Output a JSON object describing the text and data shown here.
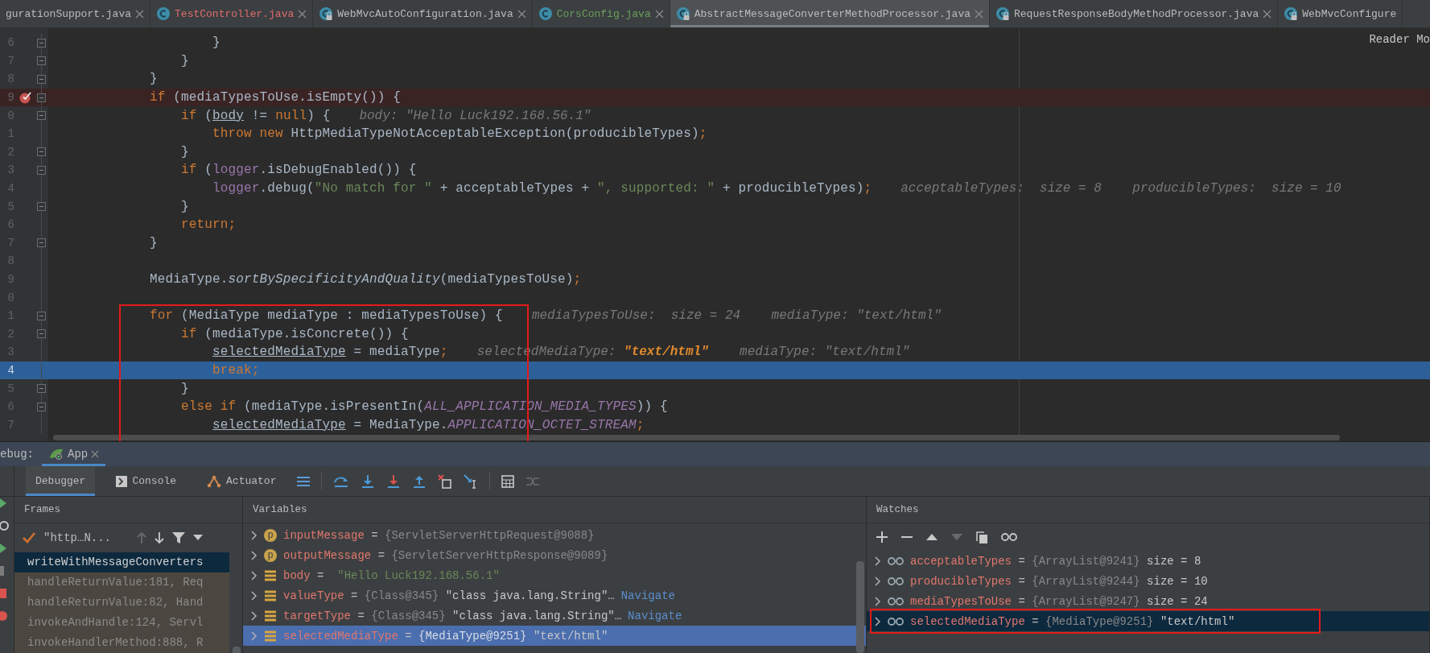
{
  "tabs": [
    {
      "label": "gurationSupport.java",
      "selected": false,
      "has_error": false,
      "is_new": false,
      "icon": false,
      "closable": true
    },
    {
      "label": "TestController.java",
      "selected": false,
      "has_error": true,
      "is_new": false,
      "icon": true,
      "locked": false,
      "closable": true
    },
    {
      "label": "WebMvcAutoConfiguration.java",
      "selected": false,
      "has_error": false,
      "is_new": false,
      "icon": true,
      "locked": true,
      "closable": true
    },
    {
      "label": "CorsConfig.java",
      "selected": false,
      "has_error": false,
      "is_new": true,
      "icon": true,
      "locked": false,
      "closable": true
    },
    {
      "label": "AbstractMessageConverterMethodProcessor.java",
      "selected": true,
      "has_error": false,
      "is_new": false,
      "icon": true,
      "locked": true,
      "closable": true
    },
    {
      "label": "RequestResponseBodyMethodProcessor.java",
      "selected": false,
      "has_error": false,
      "is_new": false,
      "icon": true,
      "locked": true,
      "closable": true
    },
    {
      "label": "WebMvcConfigure",
      "selected": false,
      "has_error": false,
      "is_new": false,
      "icon": true,
      "locked": true,
      "closable": false
    }
  ],
  "editor": {
    "reader_mode": "Reader Mo",
    "lines": [
      {
        "num": "6",
        "fold": true,
        "breakpoint": false,
        "current": false,
        "code": [
          {
            "kind": "plain",
            "t": "                }"
          }
        ]
      },
      {
        "num": "7",
        "fold": true,
        "breakpoint": false,
        "current": false,
        "code": [
          {
            "kind": "plain",
            "t": "            }"
          }
        ]
      },
      {
        "num": "8",
        "fold": true,
        "breakpoint": false,
        "current": false,
        "code": [
          {
            "kind": "plain",
            "t": "        }"
          }
        ]
      },
      {
        "num": "9",
        "fold": true,
        "breakpoint": true,
        "current": false,
        "code": [
          {
            "kind": "keyword",
            "t": "        if"
          },
          {
            "kind": "plain",
            "t": " (mediaTypesToUse.isEmpty()) {"
          }
        ]
      },
      {
        "num": "0",
        "fold": true,
        "breakpoint": false,
        "current": false,
        "code": [
          {
            "kind": "keyword",
            "t": "            if"
          },
          {
            "kind": "plain",
            "t": " ("
          },
          {
            "kind": "var",
            "t": "body"
          },
          {
            "kind": "plain",
            "t": " != "
          },
          {
            "kind": "keyword",
            "t": "null"
          },
          {
            "kind": "plain",
            "t": ") {"
          }
        ],
        "hint": [
          {
            "kind": "hint",
            "t": "body: \"Hello Luck192.168.56.1\""
          }
        ]
      },
      {
        "num": "1",
        "fold": false,
        "breakpoint": false,
        "current": false,
        "code": [
          {
            "kind": "keyword",
            "t": "                throw new"
          },
          {
            "kind": "plain",
            "t": " HttpMediaTypeNotAcceptableException(producibleTypes)"
          },
          {
            "kind": "keyword",
            "t": ";"
          }
        ]
      },
      {
        "num": "2",
        "fold": true,
        "breakpoint": false,
        "current": false,
        "code": [
          {
            "kind": "plain",
            "t": "            }"
          }
        ]
      },
      {
        "num": "3",
        "fold": true,
        "breakpoint": false,
        "current": false,
        "code": [
          {
            "kind": "keyword",
            "t": "            if"
          },
          {
            "kind": "plain",
            "t": " ("
          },
          {
            "kind": "field",
            "t": "logger"
          },
          {
            "kind": "plain",
            "t": ".isDebugEnabled()) {"
          }
        ]
      },
      {
        "num": "4",
        "fold": false,
        "breakpoint": false,
        "current": false,
        "code": [
          {
            "kind": "field",
            "t": "                logger"
          },
          {
            "kind": "plain",
            "t": ".debug("
          },
          {
            "kind": "string",
            "t": "\"No match for \""
          },
          {
            "kind": "plain",
            "t": " + acceptableTypes + "
          },
          {
            "kind": "string",
            "t": "\", supported: \""
          },
          {
            "kind": "plain",
            "t": " + producibleTypes)"
          },
          {
            "kind": "keyword",
            "t": ";"
          }
        ],
        "hint": [
          {
            "kind": "hint",
            "t": "acceptableTypes:  size = 8    producibleTypes:  size = 10"
          }
        ]
      },
      {
        "num": "5",
        "fold": true,
        "breakpoint": false,
        "current": false,
        "code": [
          {
            "kind": "plain",
            "t": "            }"
          }
        ]
      },
      {
        "num": "6",
        "fold": false,
        "breakpoint": false,
        "current": false,
        "code": [
          {
            "kind": "keyword",
            "t": "            return;"
          }
        ]
      },
      {
        "num": "7",
        "fold": true,
        "breakpoint": false,
        "current": false,
        "code": [
          {
            "kind": "plain",
            "t": "        }"
          }
        ]
      },
      {
        "num": "8",
        "fold": false,
        "breakpoint": false,
        "current": false
      },
      {
        "num": "9",
        "fold": false,
        "breakpoint": false,
        "current": false,
        "code": [
          {
            "kind": "plain",
            "t": "        MediaType."
          },
          {
            "kind": "static",
            "t": "sortBySpecificityAndQuality"
          },
          {
            "kind": "plain",
            "t": "(mediaTypesToUse)"
          },
          {
            "kind": "keyword",
            "t": ";"
          }
        ]
      },
      {
        "num": "0",
        "fold": false,
        "breakpoint": false,
        "current": false
      },
      {
        "num": "1",
        "fold": true,
        "breakpoint": false,
        "current": false,
        "code": [
          {
            "kind": "keyword",
            "t": "        for"
          },
          {
            "kind": "plain",
            "t": " (MediaType mediaType : mediaTypesToUse) {"
          }
        ],
        "hint": [
          {
            "kind": "hint",
            "t": "mediaTypesToUse:  size = 24    mediaType: \"text/html\""
          }
        ]
      },
      {
        "num": "2",
        "fold": true,
        "breakpoint": false,
        "current": false,
        "code": [
          {
            "kind": "keyword",
            "t": "            if"
          },
          {
            "kind": "plain",
            "t": " (mediaType.isConcrete()) {"
          }
        ]
      },
      {
        "num": "3",
        "fold": false,
        "breakpoint": false,
        "current": false,
        "code": [
          {
            "kind": "var",
            "t": "                selectedMediaType"
          },
          {
            "kind": "plain",
            "t": " = mediaType"
          },
          {
            "kind": "keyword",
            "t": ";"
          }
        ],
        "hint": [
          {
            "kind": "hint",
            "t": "selectedMediaType: "
          },
          {
            "kind": "changed",
            "t": "\"text/html\""
          },
          {
            "kind": "hint",
            "t": "    mediaType: \"text/html\""
          }
        ]
      },
      {
        "num": "4",
        "fold": false,
        "breakpoint": false,
        "current": true,
        "code": [
          {
            "kind": "keyword",
            "t": "                break;"
          }
        ]
      },
      {
        "num": "5",
        "fold": true,
        "breakpoint": false,
        "current": false,
        "code": [
          {
            "kind": "plain",
            "t": "            }"
          }
        ]
      },
      {
        "num": "6",
        "fold": true,
        "breakpoint": false,
        "current": false,
        "code": [
          {
            "kind": "keyword",
            "t": "            else if"
          },
          {
            "kind": "plain",
            "t": " (mediaType.isPresentIn("
          },
          {
            "kind": "constant",
            "t": "ALL_APPLICATION_MEDIA_TYPES"
          },
          {
            "kind": "plain",
            "t": ")) {"
          }
        ]
      },
      {
        "num": "7",
        "fold": false,
        "breakpoint": false,
        "current": false,
        "code": [
          {
            "kind": "var",
            "t": "                selectedMediaType"
          },
          {
            "kind": "plain",
            "t": " = MediaType."
          },
          {
            "kind": "constant",
            "t": "APPLICATION_OCTET_STREAM"
          },
          {
            "kind": "keyword",
            "t": ";"
          }
        ]
      }
    ]
  },
  "debug": {
    "label": "ebug:",
    "session": {
      "label": "App",
      "selected": true
    },
    "tabs": [
      {
        "label": "Debugger",
        "selected": true
      },
      {
        "label": "Console",
        "selected": false
      },
      {
        "label": "Actuator",
        "selected": false
      }
    ],
    "frames": {
      "title": "Frames",
      "thread": "\"http…N...",
      "items": [
        {
          "label": "writeWithMessageConverters",
          "selected": true
        },
        {
          "label": "handleReturnValue:181, Req",
          "selected": false
        },
        {
          "label": "handleReturnValue:82, Hand",
          "selected": false
        },
        {
          "label": "invokeAndHandle:124, Servl",
          "selected": false
        },
        {
          "label": "invokeHandlerMethod:888, R",
          "selected": false
        }
      ]
    },
    "variables": {
      "title": "Variables",
      "items": [
        {
          "kind": "param",
          "icon_letter": "p",
          "name": "inputMessage",
          "op": "=",
          "type": "{ServletServerHttpRequest@9088}",
          "selected": false
        },
        {
          "kind": "param",
          "icon_letter": "p",
          "name": "outputMessage",
          "op": "=",
          "type": "{ServletServerHttpResponse@9089}",
          "selected": false
        },
        {
          "kind": "field",
          "name": "body",
          "op": "=",
          "value": "\"Hello Luck192.168.56.1\"",
          "is_string": true,
          "selected": false
        },
        {
          "kind": "field",
          "name": "valueType",
          "op": "=",
          "type": "{Class@345}",
          "value": "\"class java.lang.String\"…",
          "is_string": false,
          "link": "Navigate",
          "selected": false
        },
        {
          "kind": "field",
          "name": "targetType",
          "op": "=",
          "type": "{Class@345}",
          "value": "\"class java.lang.String\"…",
          "is_string": false,
          "link": "Navigate",
          "selected": false
        },
        {
          "kind": "field",
          "name": "selectedMediaType",
          "op": "=",
          "type": "{MediaType@9251}",
          "value": "\"text/html\"",
          "is_string": false,
          "selected": true
        }
      ]
    },
    "watches": {
      "title": "Watches",
      "items": [
        {
          "name": "acceptableTypes",
          "op": "=",
          "type": "{ArrayList@9241}",
          "value": "size = 8",
          "selected": false
        },
        {
          "name": "producibleTypes",
          "op": "=",
          "type": "{ArrayList@9244}",
          "value": "size = 10",
          "selected": false
        },
        {
          "name": "mediaTypesToUse",
          "op": "=",
          "type": "{ArrayList@9247}",
          "value": "size = 24",
          "selected": false
        },
        {
          "name": "selectedMediaType",
          "op": "=",
          "type": "{MediaType@9251}",
          "value": "\"text/html\"",
          "selected": true
        }
      ]
    }
  }
}
